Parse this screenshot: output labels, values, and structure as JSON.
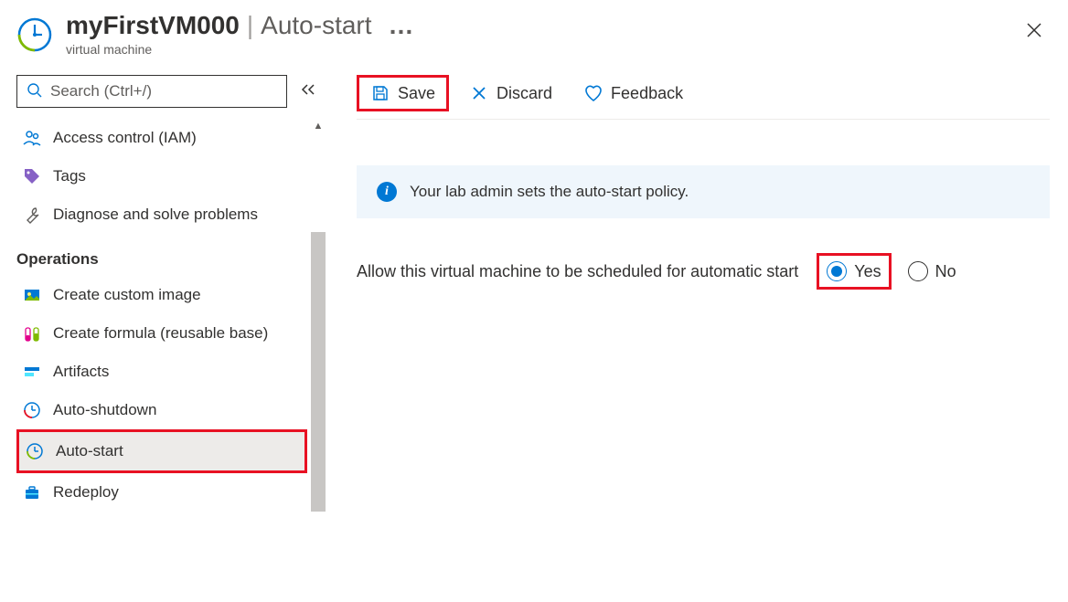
{
  "header": {
    "title_main": "myFirstVM000",
    "title_section": "Auto-start",
    "subtitle": "virtual machine",
    "more": "…"
  },
  "search": {
    "placeholder": "Search (Ctrl+/)"
  },
  "sidebar": {
    "items_top": [
      {
        "label": "Access control (IAM)"
      },
      {
        "label": "Tags"
      },
      {
        "label": "Diagnose and solve problems"
      }
    ],
    "section_operations": "Operations",
    "items_ops": [
      {
        "label": "Create custom image"
      },
      {
        "label": "Create formula (reusable base)"
      },
      {
        "label": "Artifacts"
      },
      {
        "label": "Auto-shutdown"
      },
      {
        "label": "Auto-start"
      },
      {
        "label": "Redeploy"
      }
    ]
  },
  "toolbar": {
    "save": "Save",
    "discard": "Discard",
    "feedback": "Feedback"
  },
  "info_banner": "Your lab admin sets the auto-start policy.",
  "setting": {
    "label": "Allow this virtual machine to be scheduled for automatic start",
    "option_yes": "Yes",
    "option_no": "No",
    "selected": "yes"
  },
  "colors": {
    "azure_blue": "#0078d4",
    "highlight_red": "#e81123"
  }
}
